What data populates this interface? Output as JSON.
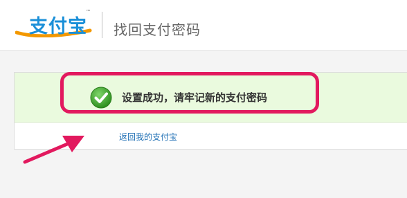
{
  "header": {
    "logo_text": "支付宝",
    "logo_tm": "™",
    "title": "找回支付密码"
  },
  "main": {
    "success_message": "设置成功，请牢记新的支付密码",
    "return_link": "返回我的支付宝"
  },
  "colors": {
    "brand_blue": "#1a8fd8",
    "logo_swoosh": "#f39800",
    "success_bg": "#eafade",
    "check_green": "#3aa12b",
    "highlight": "#e2195e",
    "link": "#2070b5"
  },
  "icons": {
    "success": "check-circle-icon",
    "annotation": "arrow-pointer-icon"
  }
}
